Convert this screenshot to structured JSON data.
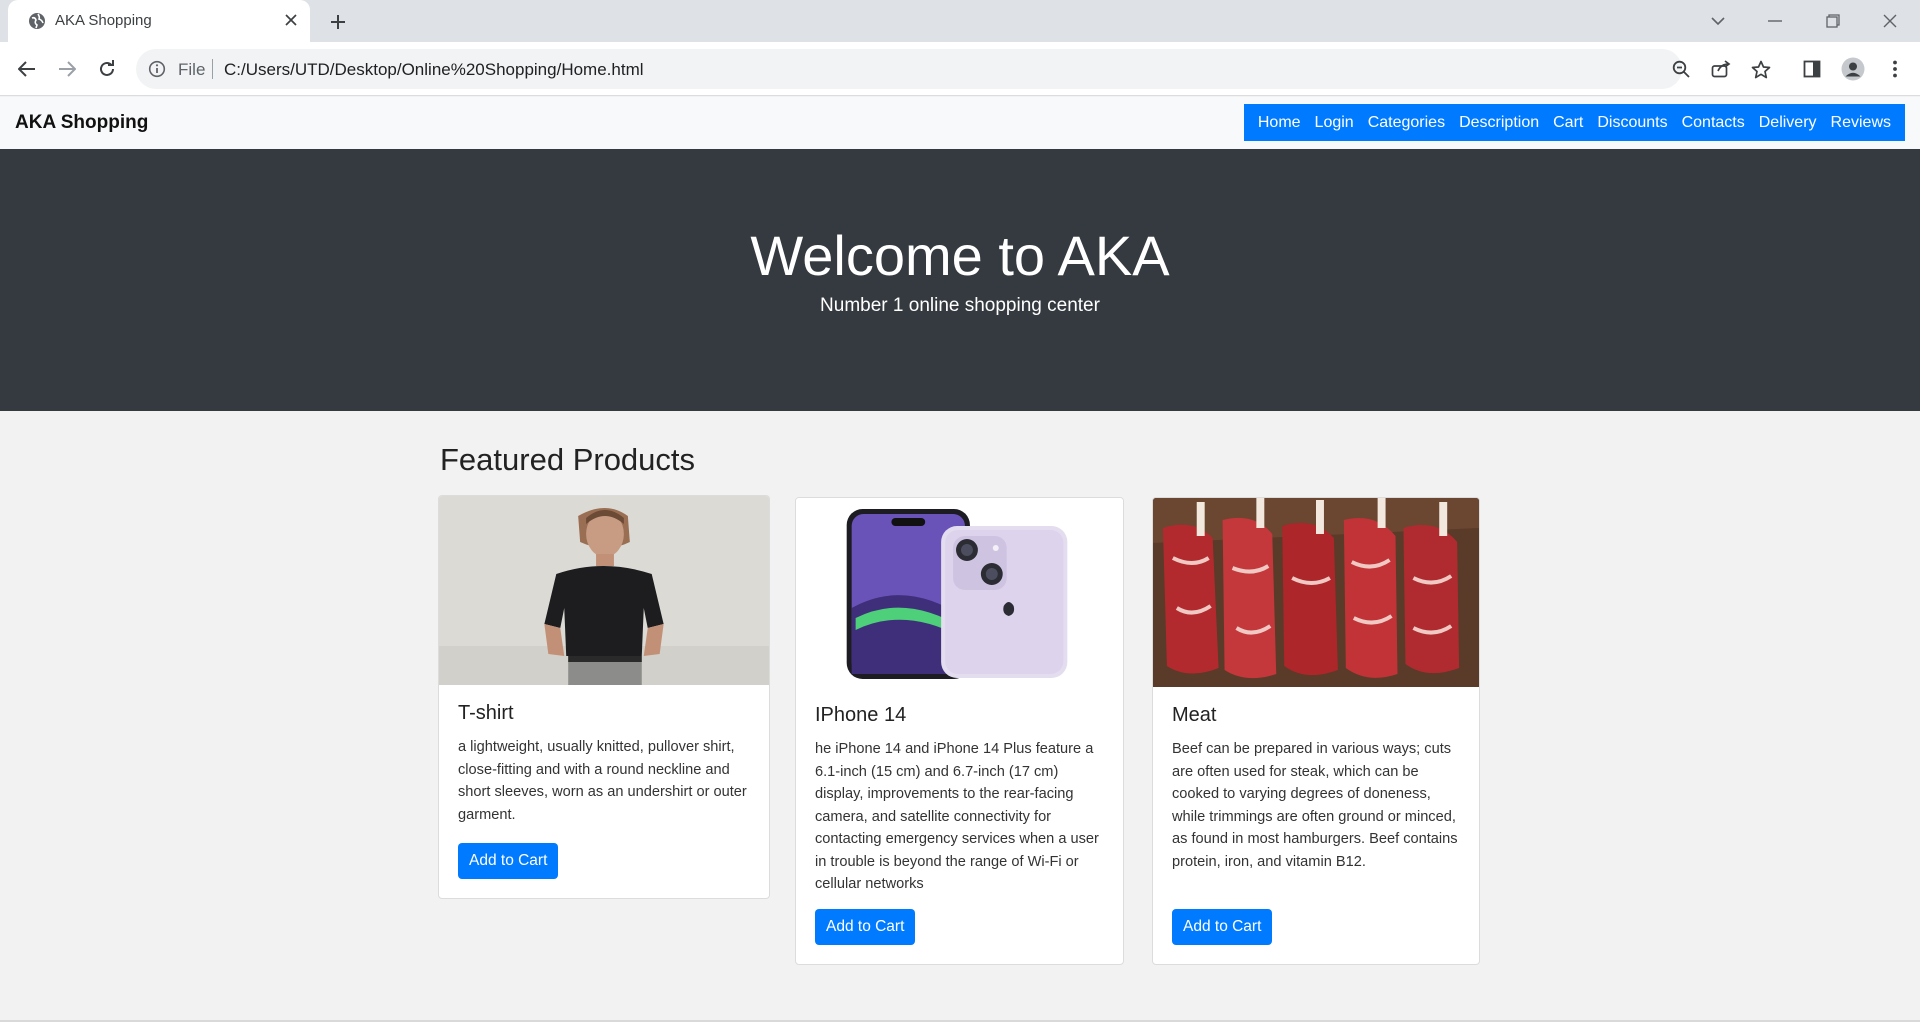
{
  "browser": {
    "tab_title": "AKA Shopping",
    "scheme_label": "File",
    "url": "C:/Users/UTD/Desktop/Online%20Shopping/Home.html"
  },
  "site": {
    "brand": "AKA Shopping",
    "menu": [
      "Home",
      "Login",
      "Categories",
      "Description",
      "Cart",
      "Discounts",
      "Contacts",
      "Delivery",
      "Reviews"
    ],
    "hero_title": "Welcome to AKA",
    "hero_subtitle": "Number 1 online shopping center",
    "section_title": "Featured Products",
    "products": [
      {
        "title": "T-shirt",
        "description": "a lightweight, usually knitted, pullover shirt, close-fitting and with a round neckline and short sleeves, worn as an undershirt or outer garment.",
        "button": "Add to Cart"
      },
      {
        "title": "IPhone 14",
        "description": "he iPhone 14 and iPhone 14 Plus feature a 6.1-inch (15 cm) and 6.7-inch (17 cm) display, improvements to the rear-facing camera, and satellite connectivity for contacting emergency services when a user in trouble is beyond the range of Wi-Fi or cellular networks",
        "button": "Add to Cart"
      },
      {
        "title": "Meat",
        "description": "Beef can be prepared in various ways; cuts are often used for steak, which can be cooked to varying degrees of doneness, while trimmings are often ground or minced, as found in most hamburgers. Beef contains protein, iron, and vitamin B12.",
        "button": "Add to Cart"
      }
    ]
  },
  "colors": {
    "primary": "#007bff",
    "hero_bg": "#343a40",
    "nav_bg": "#f8f9fa",
    "page_bg": "#f2f2f2"
  }
}
